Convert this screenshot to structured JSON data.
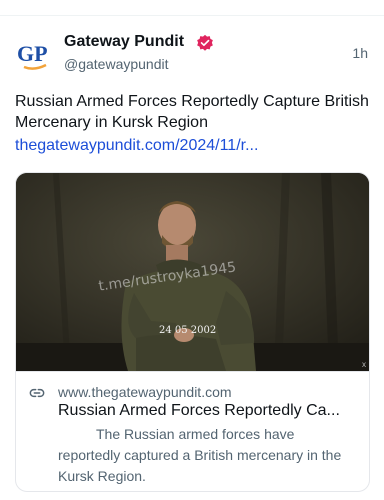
{
  "author": {
    "avatar_text": "GP",
    "name": "Gateway Pundit",
    "handle": "@gatewaypundit",
    "verified_icon": "verified-badge-icon",
    "verified_color": "#e0245e"
  },
  "post": {
    "time": "1h",
    "text": "Russian Armed Forces Reportedly Capture British Mercenary in Kursk Region",
    "link": "thegatewaypundit.com/2024/11/r..."
  },
  "card": {
    "watermark": "t.me/rustroyka1945",
    "date_stamp": "24 05 2002",
    "close_mark": "x",
    "domain": "www.thegatewaypundit.com",
    "title": "Russian Armed Forces Reportedly Ca...",
    "description": "The Russian armed forces have reportedly captured a British mercenary in the Kursk Region.",
    "link_icon": "link-icon"
  },
  "colors": {
    "link": "#1d4ed8",
    "secondary_text": "#536471",
    "brand_blue": "#1e4fa6",
    "brand_orange": "#f2a33a"
  }
}
